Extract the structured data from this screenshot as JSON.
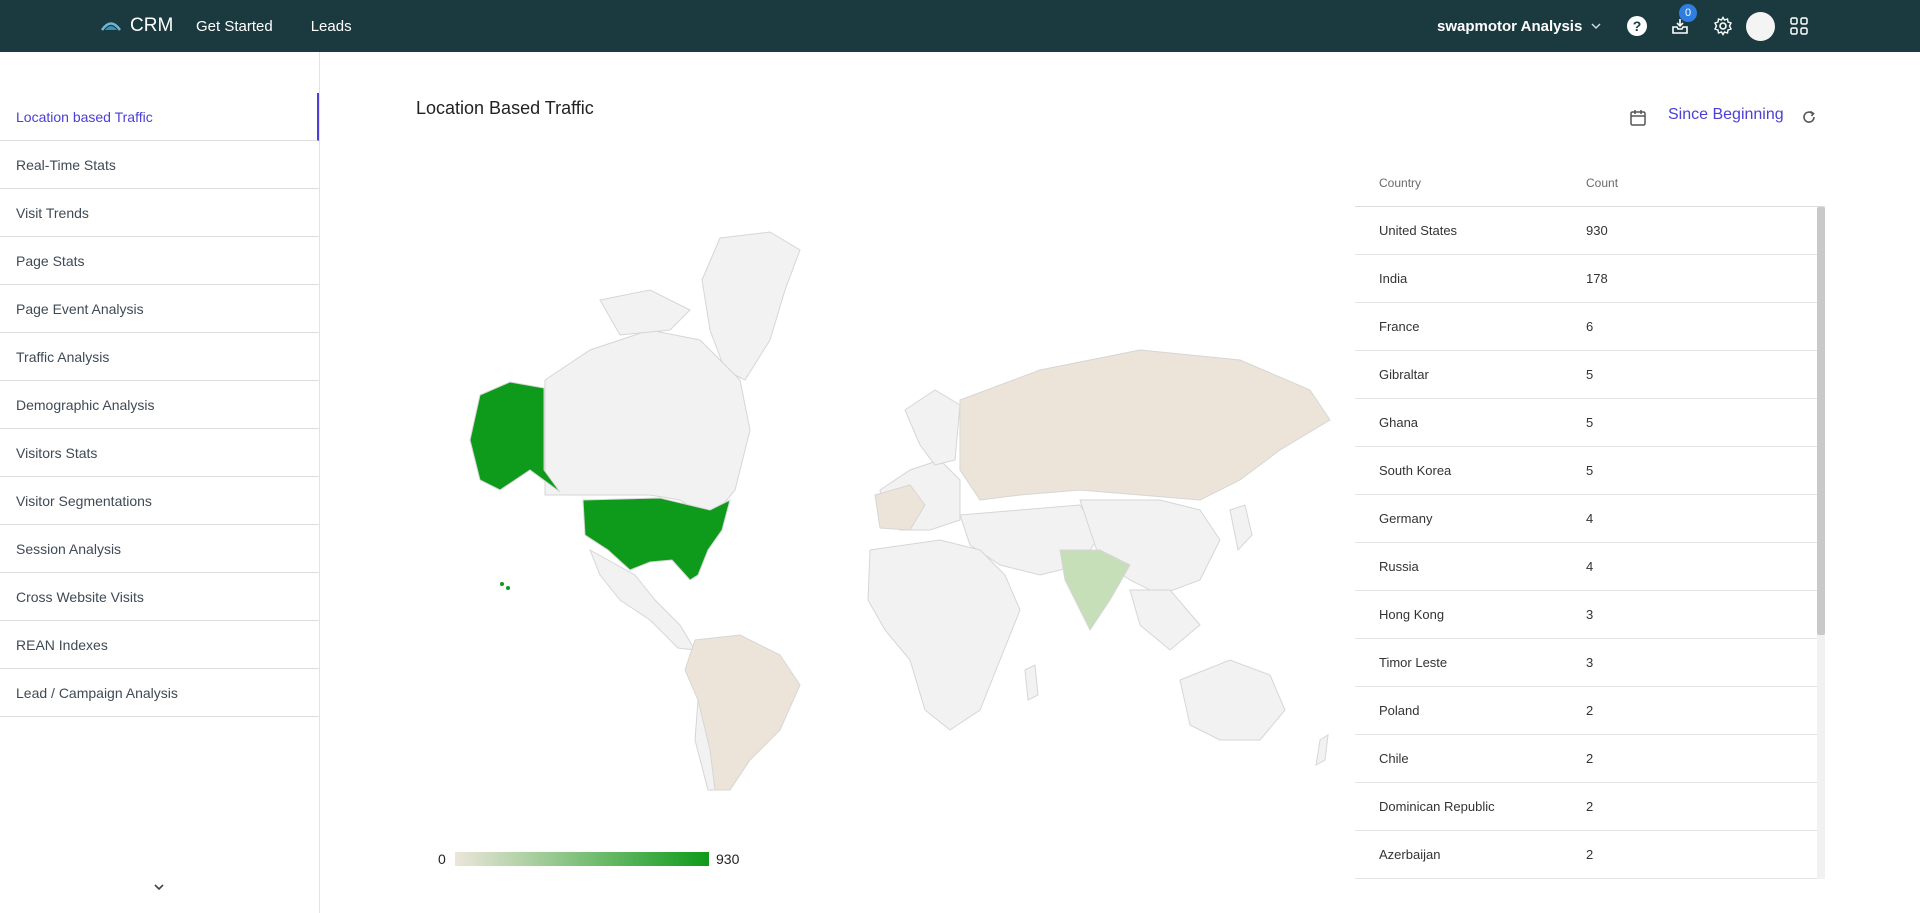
{
  "topbar": {
    "brand": "CRM",
    "nav": [
      "Get Started",
      "Leads"
    ],
    "org_name": "swapmotor Analysis",
    "notification_count": "0",
    "icons": [
      "help-icon",
      "inbox-icon",
      "settings-icon",
      "avatar",
      "apps-grid-icon"
    ]
  },
  "sidebar": {
    "items": [
      "Location based Traffic",
      "Real-Time Stats",
      "Visit Trends",
      "Page Stats",
      "Page Event Analysis",
      "Traffic Analysis",
      "Demographic Analysis",
      "Visitors Stats",
      "Visitor Segmentations",
      "Session Analysis",
      "Cross Website Visits",
      "REAN Indexes",
      "Lead / Campaign Analysis"
    ],
    "active_index": 0
  },
  "main": {
    "title": "Location Based Traffic",
    "date_range": "Since Beginning",
    "legend": {
      "min": "0",
      "max": "930"
    }
  },
  "table": {
    "headers": [
      "Country",
      "Count"
    ],
    "rows": [
      [
        "United States",
        "930"
      ],
      [
        "India",
        "178"
      ],
      [
        "France",
        "6"
      ],
      [
        "Gibraltar",
        "5"
      ],
      [
        "Ghana",
        "5"
      ],
      [
        "South Korea",
        "5"
      ],
      [
        "Germany",
        "4"
      ],
      [
        "Russia",
        "4"
      ],
      [
        "Hong Kong",
        "3"
      ],
      [
        "Timor Leste",
        "3"
      ],
      [
        "Poland",
        "2"
      ],
      [
        "Chile",
        "2"
      ],
      [
        "Dominican Republic",
        "2"
      ],
      [
        "Azerbaijan",
        "2"
      ]
    ]
  },
  "colors": {
    "topbar": "#1b3a40",
    "accent": "#4b3fd6",
    "map_high": "#0e9a1a",
    "map_mid": "#c6dfb8",
    "map_low": "#ece4d8",
    "map_none": "#f2f2f2"
  }
}
